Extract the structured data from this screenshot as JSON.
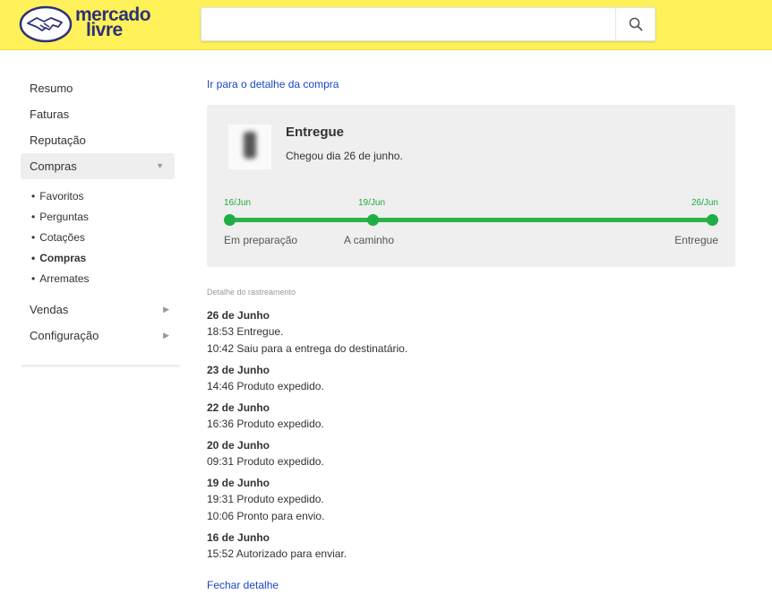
{
  "header": {
    "logo_line1": "mercado",
    "logo_line2": "livre",
    "search_placeholder": "",
    "brand_yellow": "#fff159",
    "brand_blue": "#2d3277",
    "search_icon": "search-icon"
  },
  "sidebar": {
    "items_top": [
      {
        "label": "Resumo"
      },
      {
        "label": "Faturas"
      },
      {
        "label": "Reputação"
      }
    ],
    "active": {
      "label": "Compras",
      "icon": "chevron-down-icon"
    },
    "sub_items": [
      {
        "label": "Favoritos"
      },
      {
        "label": "Perguntas"
      },
      {
        "label": "Cotações"
      },
      {
        "label": "Compras"
      },
      {
        "label": "Arremates"
      }
    ],
    "items_bottom": [
      {
        "label": "Vendas",
        "icon": "chevron-right-icon"
      },
      {
        "label": "Configuração",
        "icon": "chevron-right-icon"
      }
    ]
  },
  "main": {
    "purchase_detail_link": "Ir para o detalhe da compra",
    "status": {
      "title": "Entregue",
      "subtitle": "Chegou dia 26 de junho."
    },
    "progress": {
      "color": "#1fae45",
      "steps": [
        {
          "date": "16/Jun",
          "label": "Em preparação"
        },
        {
          "date": "19/Jun",
          "label": "A caminho"
        },
        {
          "date": "26/Jun",
          "label": "Entregue"
        }
      ]
    },
    "tracking_label": "Detalhe do rastreamento",
    "tracking": [
      {
        "day": "26 de Junho",
        "entries": [
          "18:53 Entregue.",
          "10:42 Saiu para a entrega do destinatário."
        ]
      },
      {
        "day": "23 de Junho",
        "entries": [
          "14:46 Produto expedido."
        ]
      },
      {
        "day": "22 de Junho",
        "entries": [
          "16:36 Produto expedido."
        ]
      },
      {
        "day": "20 de Junho",
        "entries": [
          "09:31 Produto expedido."
        ]
      },
      {
        "day": "19 de Junho",
        "entries": [
          "19:31 Produto expedido.",
          "10:06 Pronto para envio."
        ]
      },
      {
        "day": "16 de Junho",
        "entries": [
          "15:52 Autorizado para enviar."
        ]
      }
    ],
    "close_link": "Fechar detalhe"
  }
}
